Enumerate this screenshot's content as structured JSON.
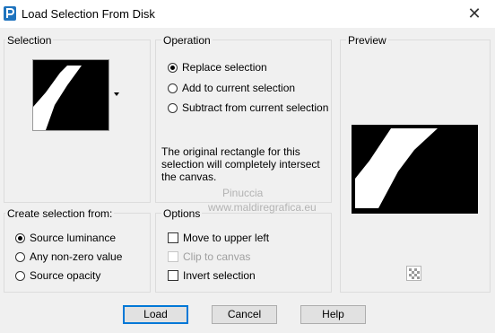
{
  "window": {
    "title": "Load Selection From Disk",
    "close_glyph": "✕"
  },
  "selection": {
    "label": "Selection"
  },
  "operation": {
    "label": "Operation",
    "options": [
      "Replace selection",
      "Add to current selection",
      "Subtract from current selection"
    ],
    "selected_index": 0,
    "info_text": "The original rectangle for this selection will completely intersect the canvas."
  },
  "preview": {
    "label": "Preview"
  },
  "create_from": {
    "label": "Create selection from:",
    "options": [
      "Source luminance",
      "Any non-zero value",
      "Source opacity"
    ],
    "selected_index": 0
  },
  "options": {
    "label": "Options",
    "move_upper_left": "Move to upper left",
    "clip_to_canvas": "Clip to canvas",
    "invert_selection": "Invert selection"
  },
  "buttons": {
    "load": "Load",
    "cancel": "Cancel",
    "help": "Help"
  },
  "watermark": {
    "line1": "Pinuccia",
    "line2": "www.maldiregrafica.eu"
  },
  "colors": {
    "accent": "#0078d7",
    "app_icon": "#1e73be"
  },
  "icons": {
    "app": "psp-icon",
    "close": "close-icon",
    "resize": "checker-icon"
  }
}
